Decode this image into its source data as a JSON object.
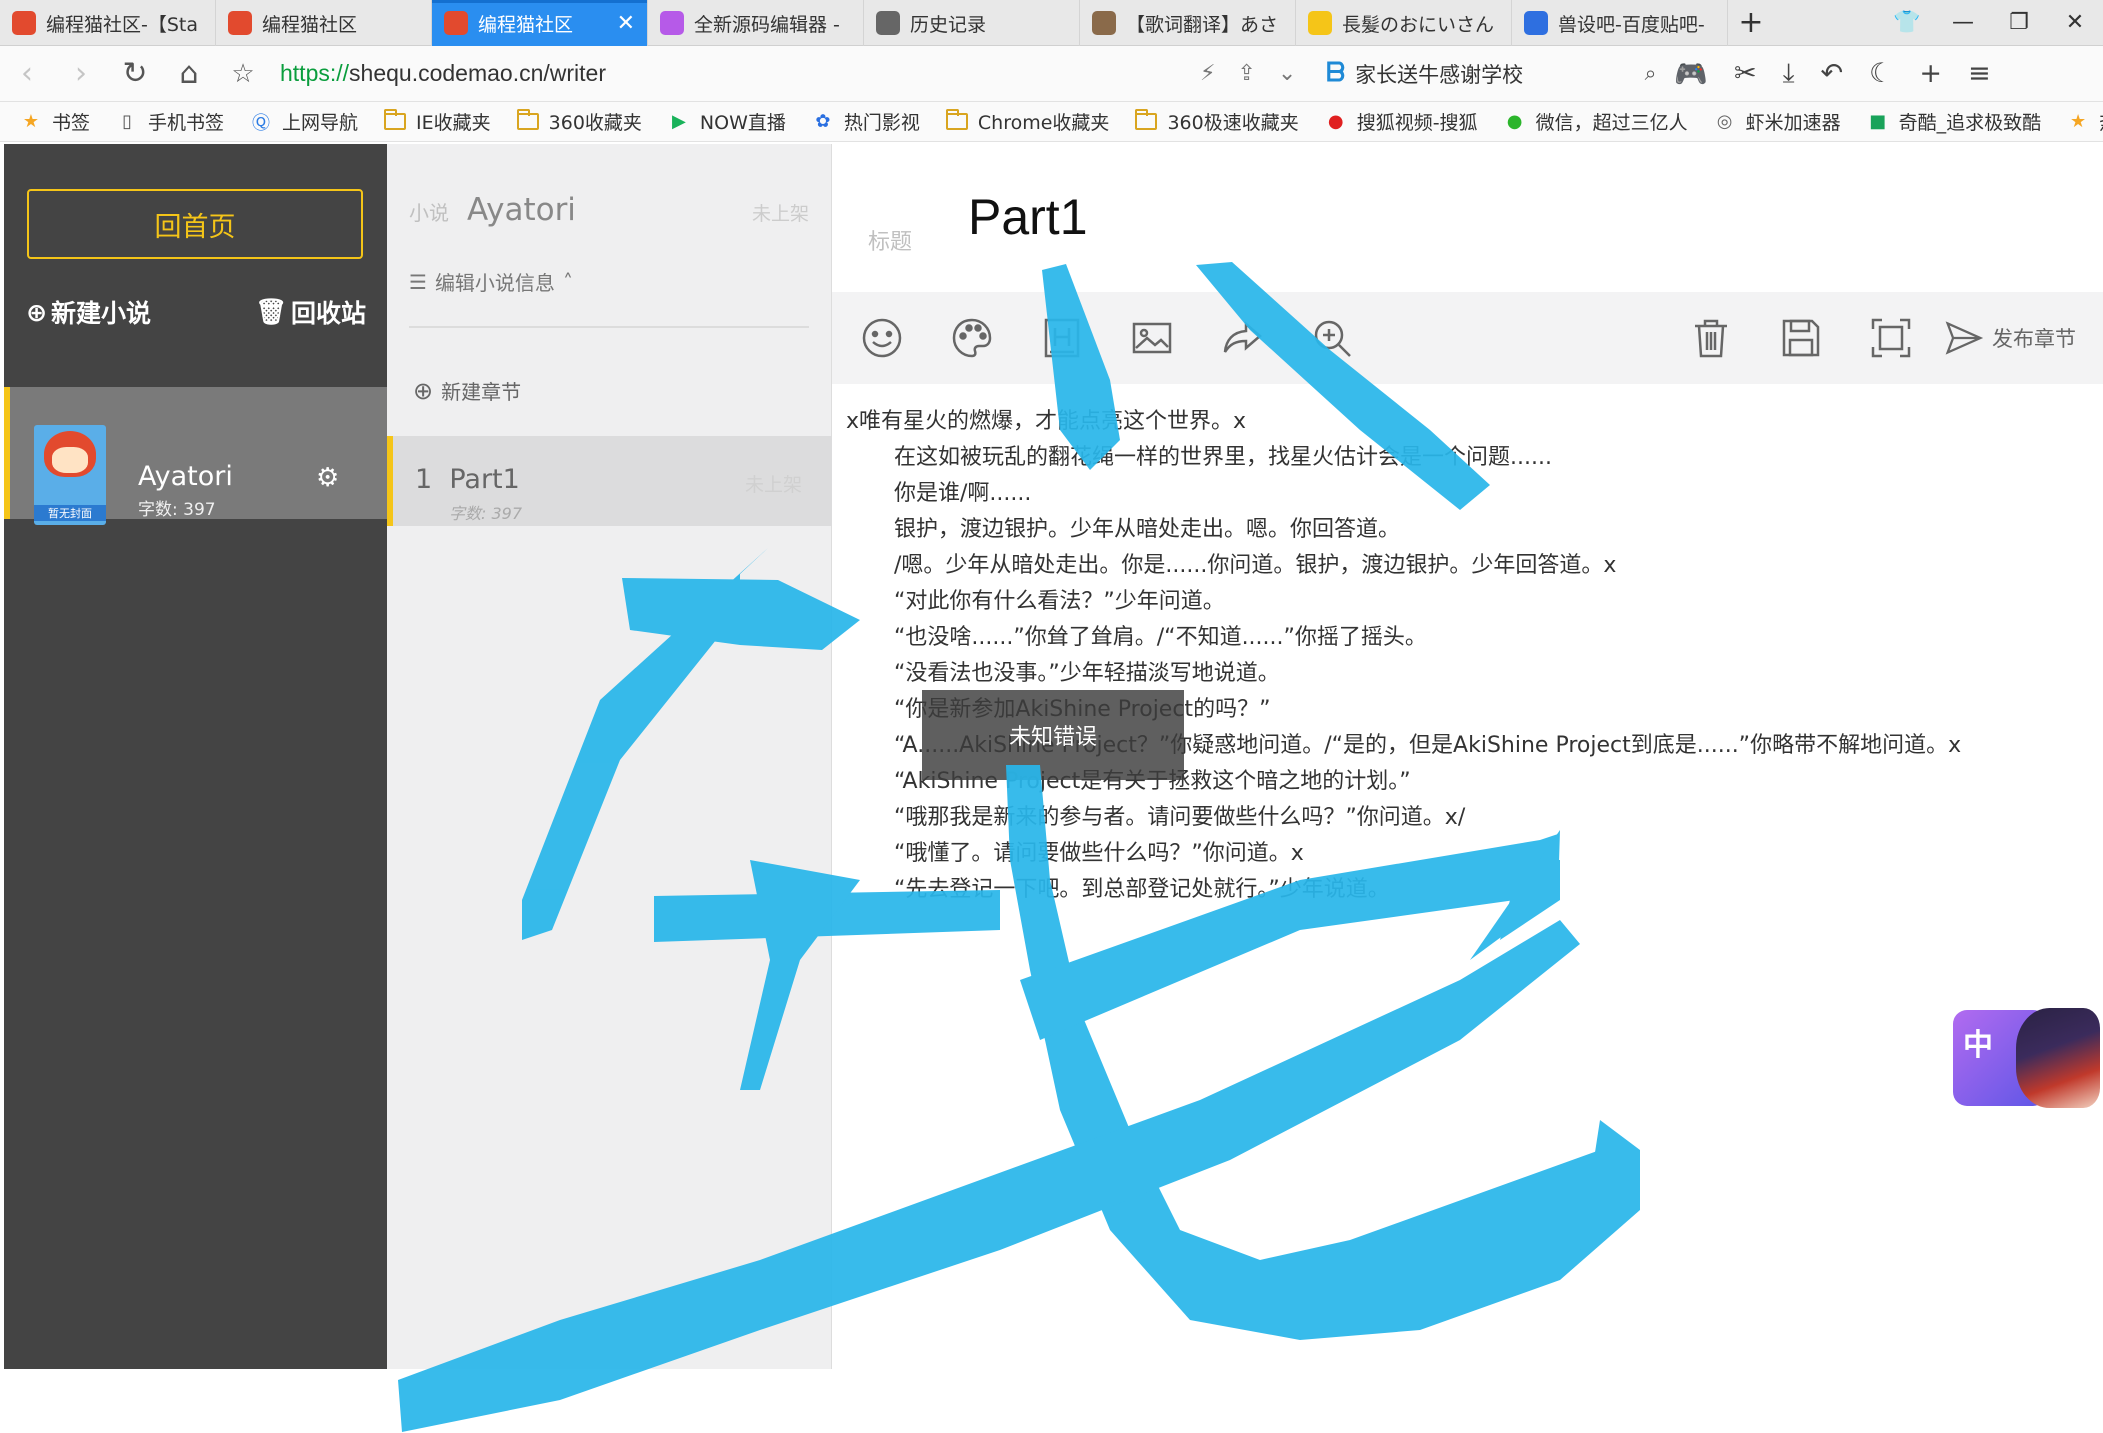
{
  "browser": {
    "tabs": [
      {
        "title": "编程猫社区-【Sta",
        "icon_color": "#e24a2e",
        "active": false
      },
      {
        "title": "编程猫社区",
        "icon_color": "#e24a2e",
        "active": false
      },
      {
        "title": "编程猫社区",
        "icon_color": "#e24a2e",
        "active": true
      },
      {
        "title": "全新源码编辑器 -",
        "icon_color": "#b65ae8",
        "active": false
      },
      {
        "title": "历史记录",
        "icon_color": "#666666",
        "active": false
      },
      {
        "title": "【歌词翻译】あさ",
        "icon_color": "#8a6a4a",
        "active": false
      },
      {
        "title": "長髪のおにいさん",
        "icon_color": "#f5c518",
        "active": false
      },
      {
        "title": "兽设吧-百度贴吧-",
        "icon_color": "#2e6fe0",
        "active": false
      }
    ],
    "url_scheme": "https://",
    "url_rest": "shequ.codemao.cn/writer",
    "search_text": "家长送牛感谢学校",
    "bookmarks": [
      {
        "label": "书签",
        "icon": "star-icon"
      },
      {
        "label": "手机书签",
        "icon": "phone-icon"
      },
      {
        "label": "上网导航",
        "icon": "nav-icon"
      },
      {
        "label": "IE收藏夹",
        "icon": "folder-icon"
      },
      {
        "label": "360收藏夹",
        "icon": "folder-icon"
      },
      {
        "label": "NOW直播",
        "icon": "now-icon"
      },
      {
        "label": "热门影视",
        "icon": "paw-icon"
      },
      {
        "label": "Chrome收藏夹",
        "icon": "folder-icon"
      },
      {
        "label": "360极速收藏夹",
        "icon": "folder-icon"
      },
      {
        "label": "搜狐视频-搜狐",
        "icon": "sohu-icon"
      },
      {
        "label": "微信，超过三亿人",
        "icon": "wechat-icon"
      },
      {
        "label": "虾米加速器",
        "icon": "globe-icon"
      },
      {
        "label": "奇酷_追求极致酷",
        "icon": "qiku-icon"
      },
      {
        "label": "热门游戏",
        "icon": "star-icon"
      }
    ]
  },
  "sidebar": {
    "home_button": "回首页",
    "new_novel": "新建小说",
    "recycle": "回收站",
    "novel": {
      "name": "Ayatori",
      "word_count": "字数: 397",
      "cover_caption": "暂无封面"
    }
  },
  "chapters_panel": {
    "novel_label": "小说",
    "novel_name": "Ayatori",
    "status": "未上架",
    "edit_info": "编辑小说信息",
    "new_chapter": "新建章节",
    "chapter": {
      "title": "1  Part1",
      "status": "未上架",
      "word_count": "字数: 397"
    }
  },
  "editor": {
    "title_label": "标题",
    "title": "Part1",
    "publish": "发布章节",
    "lines": [
      {
        "text": "x唯有星火的燃爆，才能点亮这个世界。x",
        "indent": false
      },
      {
        "text": "在这如被玩乱的翻花绳一样的世界里，找星火估计会是一个问题......",
        "indent": true
      },
      {
        "text": "你是谁/啊......",
        "indent": true
      },
      {
        "text": "银护，渡边银护。少年从暗处走出。嗯。你回答道。",
        "indent": true
      },
      {
        "text": "/嗯。少年从暗处走出。你是......你问道。银护，渡边银护。少年回答道。x",
        "indent": true
      },
      {
        "text": "“对此你有什么看法？”少年问道。",
        "indent": true
      },
      {
        "text": "“也没啥......”你耸了耸肩。/“不知道......”你摇了摇头。",
        "indent": true
      },
      {
        "text": "“没看法也没事。”少年轻描淡写地说道。",
        "indent": true
      },
      {
        "text": "“你是新参加AkiShine Project的吗？”",
        "indent": true
      },
      {
        "text": "“A......AkiShine Project？”你疑惑地问道。/“是的，但是AkiShine Project到底是......”你略带不解地问道。x",
        "indent": true
      },
      {
        "text": "“AkiShine Project是有关于拯救这个暗之地的计划。”",
        "indent": true
      },
      {
        "text": "“哦那我是新来的参与者。请问要做些什么吗？”你问道。x/",
        "indent": true
      },
      {
        "text": "“哦懂了。请问要做些什么吗？”你问道。x",
        "indent": true
      },
      {
        "text": "“先去登记一下吧。到总部登记处就行。”少年说道。",
        "indent": true
      }
    ],
    "toast": "未知错误"
  },
  "float_widget": {
    "label": "中"
  },
  "overlay": {
    "color": "#29b6ea"
  }
}
